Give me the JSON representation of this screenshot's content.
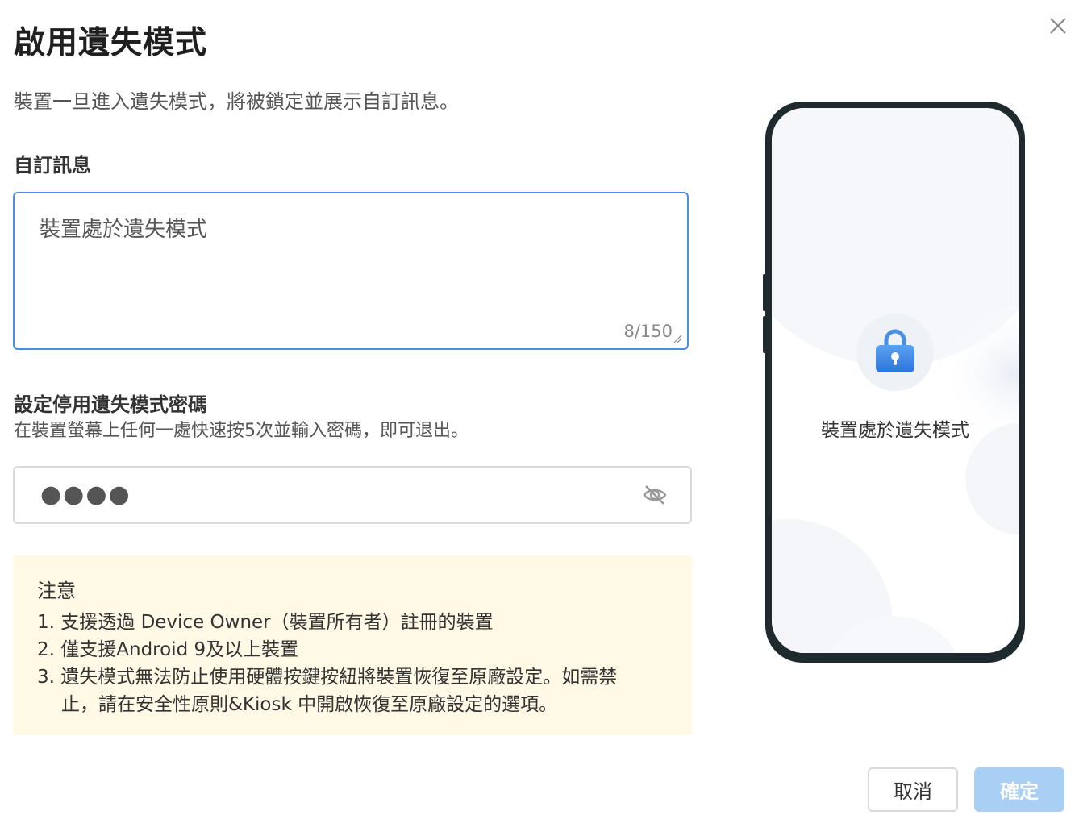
{
  "dialog": {
    "title": "啟用遺失模式",
    "description": "裝置一旦進入遺失模式，將被鎖定並展示自訂訊息。"
  },
  "custom_message": {
    "label": "自訂訊息",
    "value": "裝置處於遺失模式",
    "counter": "8/150"
  },
  "password": {
    "label": "設定停用遺失模式密碼",
    "hint": "在裝置螢幕上任何一處快速按5次並輸入密碼，即可退出。",
    "masked_value": "●●●●",
    "visibility_icon": "eye-off-icon"
  },
  "notice": {
    "title": "注意",
    "items": [
      "1. 支援透過 Device Owner（裝置所有者）註冊的裝置",
      "2. 僅支援Android 9及以上裝置",
      "3. 遺失模式無法防止使用硬體按鍵按紐將裝置恢復至原廠設定。如需禁",
      "止，請在安全性原則&Kiosk 中開啟恢復至原廠設定的選項。"
    ]
  },
  "preview": {
    "message": "裝置處於遺失模式",
    "icon": "lock-icon"
  },
  "buttons": {
    "cancel": "取消",
    "ok": "確定"
  },
  "colors": {
    "accent": "#4a90e2",
    "ok_disabled": "#a9cff5",
    "notice_bg": "#fff9e6",
    "phone_frame": "#1e2a2d"
  }
}
